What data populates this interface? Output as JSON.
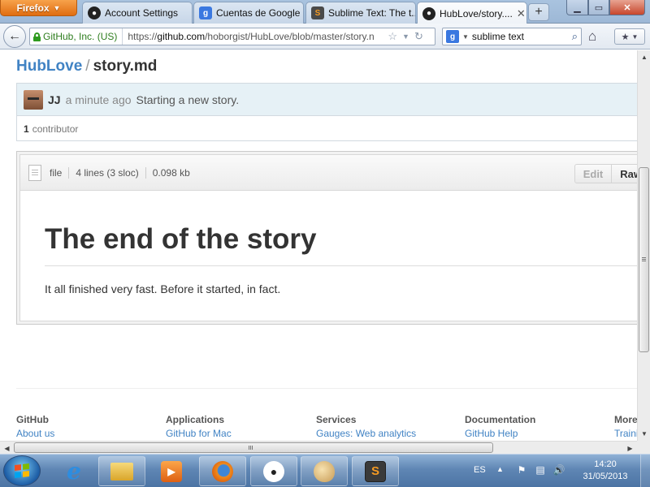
{
  "browser": {
    "app_button": "Firefox",
    "tabs": [
      {
        "label": "Account Settings",
        "favicon": "github-favicon"
      },
      {
        "label": "Cuentas de Google",
        "favicon": "google-favicon"
      },
      {
        "label": "Sublime Text: The t...",
        "favicon": "sublime-favicon"
      },
      {
        "label": "HubLove/story....",
        "favicon": "github-favicon",
        "active": true
      }
    ],
    "identity": "GitHub, Inc. (US)",
    "url_prefix": "https://",
    "url_host": "github.com",
    "url_path": "/hoborgist/HubLove/blob/master/story.n",
    "search_engine": "g",
    "search_value": "sublime text"
  },
  "page": {
    "repo": "HubLove",
    "separator": "/",
    "filename": "story.md",
    "commit": {
      "author": "JJ",
      "time": "a minute ago",
      "message": "Starting a new story."
    },
    "contributors": {
      "count": "1",
      "label": "contributor"
    },
    "file_meta": {
      "type": "file",
      "lines": "4 lines (3 sloc)",
      "size": "0.098 kb"
    },
    "buttons": {
      "edit": "Edit",
      "raw": "Raw"
    },
    "content": {
      "heading": "The end of the story",
      "paragraph": "It all finished very fast. Before it started, in fact."
    },
    "footer": [
      {
        "title": "GitHub",
        "link": "About us"
      },
      {
        "title": "Applications",
        "link": "GitHub for Mac"
      },
      {
        "title": "Services",
        "link": "Gauges: Web analytics"
      },
      {
        "title": "Documentation",
        "link": "GitHub Help"
      },
      {
        "title": "More",
        "link": "Traini"
      }
    ]
  },
  "taskbar": {
    "language": "ES",
    "time": "14:20",
    "date": "31/05/2013",
    "pinned": [
      "internet-explorer",
      "windows-explorer",
      "media-player",
      "firefox",
      "github",
      "paint",
      "sublime-text"
    ]
  },
  "colors": {
    "link": "#4183c4",
    "commit_bg": "#e6f1f6",
    "firefox_orange": "#e06d10"
  }
}
